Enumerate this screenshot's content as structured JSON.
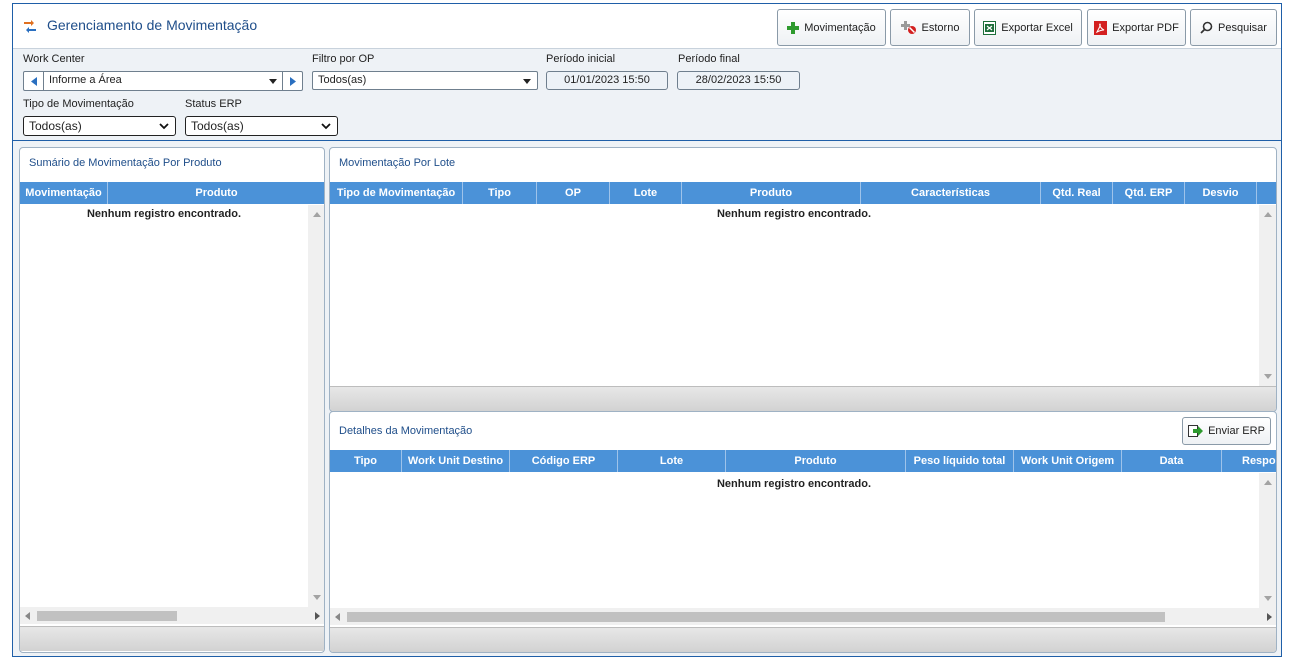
{
  "header": {
    "title": "Gerenciamento de Movimentação",
    "buttons": {
      "movimentacao": "Movimentação",
      "estorno": "Estorno",
      "exportar_excel": "Exportar Excel",
      "exportar_pdf": "Exportar PDF",
      "pesquisar": "Pesquisar"
    }
  },
  "filters": {
    "work_center": {
      "label": "Work Center",
      "value": "Informe a Área"
    },
    "filtro_op": {
      "label": "Filtro por OP",
      "value": "Todos(as)"
    },
    "periodo_inicial": {
      "label": "Período inicial",
      "value": "01/01/2023 15:50"
    },
    "periodo_final": {
      "label": "Período final",
      "value": "28/02/2023 15:50"
    },
    "tipo_movimentacao": {
      "label": "Tipo de Movimentação",
      "value": "Todos(as)"
    },
    "status_erp": {
      "label": "Status ERP",
      "value": "Todos(as)"
    }
  },
  "summary_panel": {
    "title": "Sumário de Movimentação Por Produto",
    "columns": [
      "Movimentação",
      "Produto"
    ],
    "empty_message": "Nenhum registro encontrado."
  },
  "lot_panel": {
    "title": "Movimentação Por Lote",
    "columns": [
      "Tipo de Movimentação",
      "Tipo",
      "OP",
      "Lote",
      "Produto",
      "Características",
      "Qtd. Real",
      "Qtd. ERP",
      "Desvio"
    ],
    "empty_message": "Nenhum registro encontrado."
  },
  "details_panel": {
    "title": "Detalhes da Movimentação",
    "send_button": "Enviar ERP",
    "columns": [
      "Tipo",
      "Work Unit Destino",
      "Código ERP",
      "Lote",
      "Produto",
      "Peso líquido total",
      "Work Unit Origem",
      "Data",
      "Respons"
    ],
    "empty_message": "Nenhum registro encontrado."
  },
  "colors": {
    "accent": "#1f4e8a",
    "grid_header": "#4b92d8",
    "frame_border": "#1f5fa8"
  }
}
